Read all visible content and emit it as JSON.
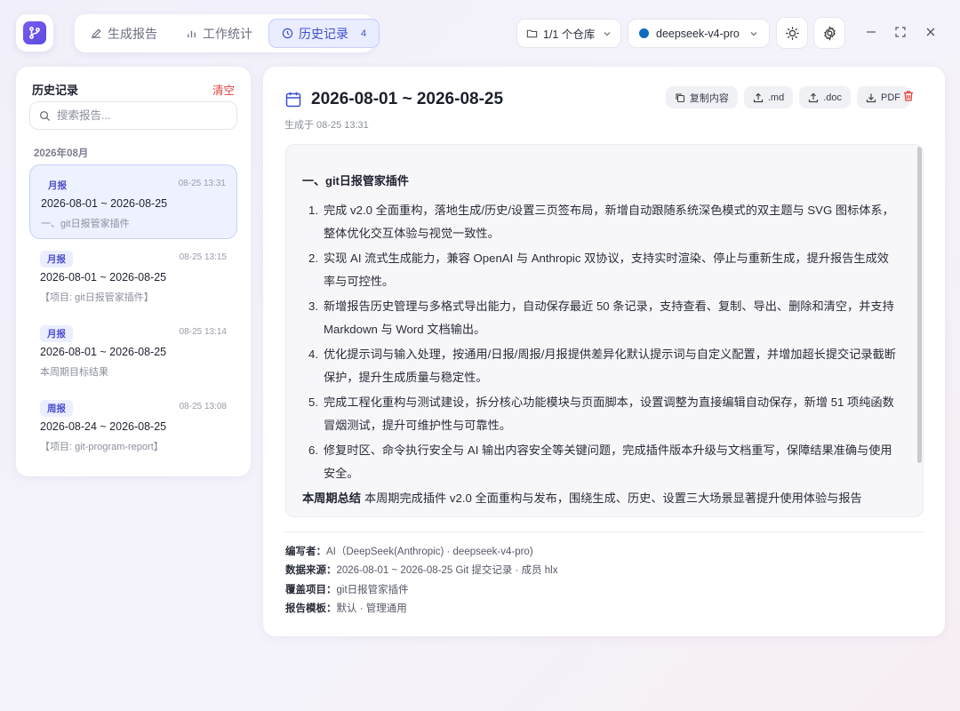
{
  "header": {
    "tabs": [
      {
        "label": "生成报告",
        "icon": "pencil-icon"
      },
      {
        "label": "工作统计",
        "icon": "bar-chart-icon"
      },
      {
        "label": "历史记录",
        "icon": "clock-icon",
        "count": "4"
      }
    ],
    "repo_select": {
      "label": "1/1 个仓库",
      "icon": "folder-icon"
    },
    "model_select": {
      "label": "deepseek-v4-pro",
      "dot_color": "#0f6cbd"
    },
    "accent": "#3d4fd0"
  },
  "sidebar": {
    "title": "历史记录",
    "clear_label": "清空",
    "search_placeholder": "搜索报告...",
    "month": "2026年08月",
    "items": [
      {
        "badge": "月报",
        "time": "08-25 13:31",
        "range": "2026-08-01 ~ 2026-08-25",
        "sub": "一、git日报管家插件",
        "active": true
      },
      {
        "badge": "月报",
        "time": "08-25 13:15",
        "range": "2026-08-01 ~ 2026-08-25",
        "sub": "【项目: git日报管家插件】"
      },
      {
        "badge": "月报",
        "time": "08-25 13:14",
        "range": "2026-08-01 ~ 2026-08-25",
        "sub": "本周期目标结果"
      },
      {
        "badge": "周报",
        "time": "08-25 13:08",
        "range": "2026-08-24 ~ 2026-08-25",
        "sub": "【项目: git-program-report】"
      }
    ]
  },
  "report": {
    "title": "2026-08-01 ~ 2026-08-25",
    "generated": "生成于 08-25 13:31",
    "actions": {
      "copy": "复制内容",
      "md": ".md",
      "doc": ".doc",
      "pdf": "PDF"
    },
    "section_heading": "一、git日报管家插件",
    "items": [
      {
        "num": "1.",
        "text": "完成 v2.0 全面重构，落地生成/历史/设置三页签布局，新增自动跟随系统深色模式的双主题与 SVG 图标体系，整体优化交互体验与视觉一致性。"
      },
      {
        "num": "2.",
        "text": "实现 AI 流式生成能力，兼容 OpenAI 与 Anthropic 双协议，支持实时渲染、停止与重新生成，提升报告生成效率与可控性。"
      },
      {
        "num": "3.",
        "text": "新增报告历史管理与多格式导出能力，自动保存最近 50 条记录，支持查看、复制、导出、删除和清空，并支持 Markdown 与 Word 文档输出。"
      },
      {
        "num": "4.",
        "text": "优化提示词与输入处理，按通用/日报/周报/月报提供差异化默认提示词与自定义配置，并增加超长提交记录截断保护，提升生成质量与稳定性。"
      },
      {
        "num": "5.",
        "text": "完成工程化重构与测试建设，拆分核心功能模块与页面脚本，设置调整为直接编辑自动保存，新增 51 项纯函数冒烟测试，提升可维护性与可靠性。"
      },
      {
        "num": "6.",
        "text": "修复时区、命令执行安全与 AI 输出内容安全等关键问题，完成插件版本升级与文档重写，保障结果准确与使用安全。"
      }
    ],
    "summary_label": "本周期总结",
    "summary_text": "本周期完成插件 v2.0 全面重构与发布，围绕生成、历史、设置三大场景显著提升使用体验与报告",
    "meta": [
      {
        "key": "编写者：",
        "value": "AI（DeepSeek(Anthropic) · deepseek-v4-pro)"
      },
      {
        "key": "数据来源：",
        "value": "2026-08-01 ~ 2026-08-25 Git 提交记录 · 成员 hlx"
      },
      {
        "key": "覆盖项目：",
        "value": "git日报管家插件"
      },
      {
        "key": "报告模板：",
        "value": "默认 · 管理通用"
      }
    ]
  }
}
